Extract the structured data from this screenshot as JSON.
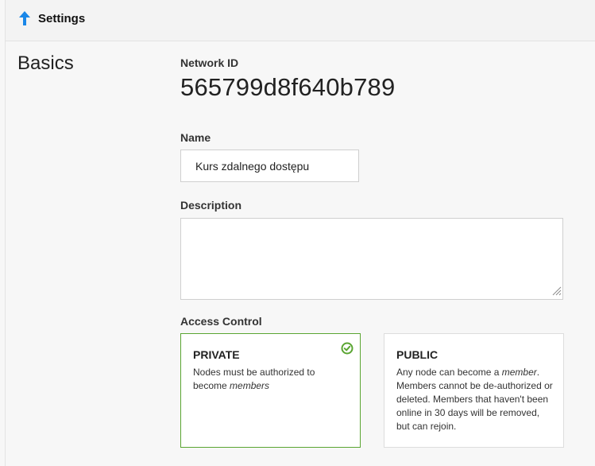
{
  "header": {
    "title": "Settings",
    "icon": "arrow-up-icon",
    "accent": "#1a87e8"
  },
  "section": {
    "title": "Basics"
  },
  "network_id": {
    "label": "Network ID",
    "value": "565799d8f640b789"
  },
  "name_field": {
    "label": "Name",
    "value": "Kurs zdalnego dostępu"
  },
  "description_field": {
    "label": "Description",
    "value": ""
  },
  "access_control": {
    "label": "Access Control",
    "private": {
      "title": "PRIVATE",
      "desc_pre": "Nodes must be authorized to become ",
      "desc_em": "members",
      "desc_post": "",
      "selected": true,
      "color": "#5aa532"
    },
    "public": {
      "title": "PUBLIC",
      "desc_pre": "Any node can become a ",
      "desc_em": "member",
      "desc_post": ". Members cannot be de-authorized or deleted. Members that haven't been online in 30 days will be removed, but can rejoin.",
      "selected": false
    }
  }
}
